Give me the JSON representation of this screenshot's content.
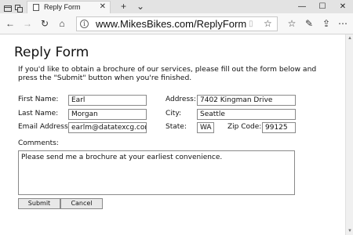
{
  "browser": {
    "tab_title": "Reply Form",
    "tab_close": "✕",
    "new_tab": "+",
    "tab_menu": "⌄",
    "window_controls": {
      "minimize": "—",
      "maximize": "☐",
      "close": "✕"
    },
    "address_url": "www.MikesBikes.com/ReplyForm",
    "nav": {
      "back": "←",
      "forward": "→",
      "refresh": "↻",
      "home": "⌂"
    },
    "address_icons": {
      "info": "i",
      "reading_view": "▯",
      "favorite": "☆"
    },
    "toolbar_icons": {
      "favorites": "☆",
      "reading_list": "✎",
      "share": "⇪",
      "more": "⋯"
    }
  },
  "page": {
    "title": "Reply Form",
    "intro": "If you'd like to obtain a brochure of our services, please fill out the form below and press the \"Submit\" button when you're finished."
  },
  "form": {
    "first_name": {
      "label": "First Name:",
      "value": "Earl"
    },
    "last_name": {
      "label": "Last Name:",
      "value": "Morgan"
    },
    "email": {
      "label": "Email Address:",
      "value": "earlm@datatexcg.com"
    },
    "address": {
      "label": "Address:",
      "value": "7402 Kingman Drive"
    },
    "city": {
      "label": "City:",
      "value": "Seattle"
    },
    "state": {
      "label": "State:",
      "value": "WA"
    },
    "zip": {
      "label": "Zip Code:",
      "value": "99125"
    },
    "comments": {
      "label": "Comments:",
      "value": "Please send me a brochure at your earliest convenience."
    },
    "submit_label": "Submit",
    "cancel_label": "Cancel"
  }
}
